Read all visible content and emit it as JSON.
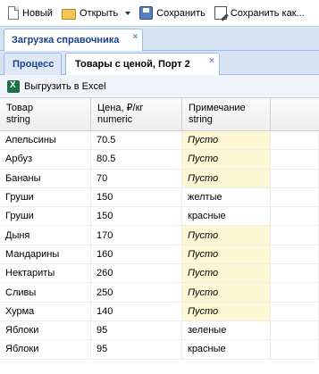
{
  "toolbar": {
    "new_label": "Новый",
    "open_label": "Открыть",
    "save_label": "Сохранить",
    "saveas_label": "Сохранить как..."
  },
  "top_tabs": [
    {
      "label": "Загрузка справочника",
      "close": "×"
    }
  ],
  "sub_tabs": [
    {
      "label": "Процесс"
    },
    {
      "label": "Товары с ценой, Порт 2",
      "close": "×"
    }
  ],
  "grid_toolbar": {
    "export_label": "Выгрузить в Excel"
  },
  "grid": {
    "columns": [
      {
        "title": "Товар\nstring"
      },
      {
        "title": "Цена, ₽/кг\nnumeric"
      },
      {
        "title": "Примечание\nstring"
      }
    ],
    "rows": [
      {
        "product": "Апельсины",
        "price": "70.5",
        "note": "Пусто",
        "empty": true
      },
      {
        "product": "Арбуз",
        "price": "80.5",
        "note": "Пусто",
        "empty": true
      },
      {
        "product": "Бананы",
        "price": "70",
        "note": "Пусто",
        "empty": true
      },
      {
        "product": "Груши",
        "price": "150",
        "note": "желтые",
        "empty": false
      },
      {
        "product": "Груши",
        "price": "150",
        "note": "красные",
        "empty": false
      },
      {
        "product": "Дыня",
        "price": "170",
        "note": "Пусто",
        "empty": true
      },
      {
        "product": "Мандарины",
        "price": "160",
        "note": "Пусто",
        "empty": true
      },
      {
        "product": "Нектариты",
        "price": "260",
        "note": "Пусто",
        "empty": true
      },
      {
        "product": "Сливы",
        "price": "250",
        "note": "Пусто",
        "empty": true
      },
      {
        "product": "Хурма",
        "price": "140",
        "note": "Пусто",
        "empty": true
      },
      {
        "product": "Яблоки",
        "price": "95",
        "note": "зеленые",
        "empty": false
      },
      {
        "product": "Яблоки",
        "price": "95",
        "note": "красные",
        "empty": false
      }
    ]
  }
}
